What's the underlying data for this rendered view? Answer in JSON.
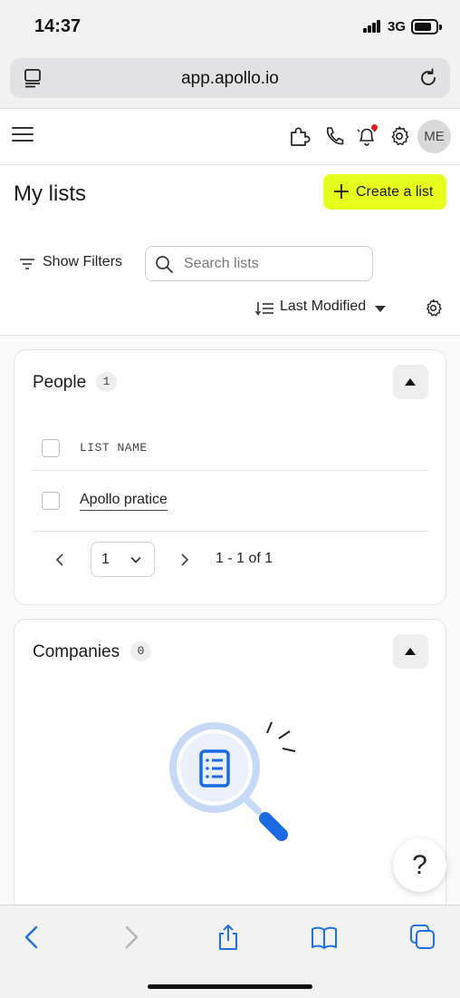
{
  "status_bar": {
    "time": "14:37",
    "network": "3G"
  },
  "browser": {
    "url": "app.apollo.io"
  },
  "header": {
    "avatar_initials": "ME"
  },
  "page": {
    "title": "My lists",
    "create_button": "Create a list",
    "show_filters": "Show Filters",
    "search_placeholder": "Search lists",
    "sort_label": "Last Modified"
  },
  "people_section": {
    "title": "People",
    "count": "1",
    "column_header": "LIST NAME",
    "rows": [
      {
        "name": "Apollo pratice"
      }
    ],
    "pagination": {
      "current_page": "1",
      "range": "1 - 1 of 1"
    }
  },
  "companies_section": {
    "title": "Companies",
    "count": "0"
  },
  "help": {
    "label": "?"
  },
  "colors": {
    "accent": "#E7FF1C",
    "link_blue": "#1B6AE4",
    "notification_red": "#E0211B"
  },
  "icons": [
    "reader-icon",
    "reload-icon",
    "hamburger-icon",
    "extension-icon",
    "phone-icon",
    "bell-icon",
    "gear-icon",
    "filter-icon",
    "search-icon",
    "sort-icon",
    "chevron-down-icon",
    "chevron-left-icon",
    "chevron-right-icon",
    "share-icon",
    "bookmarks-icon",
    "tabs-icon"
  ]
}
